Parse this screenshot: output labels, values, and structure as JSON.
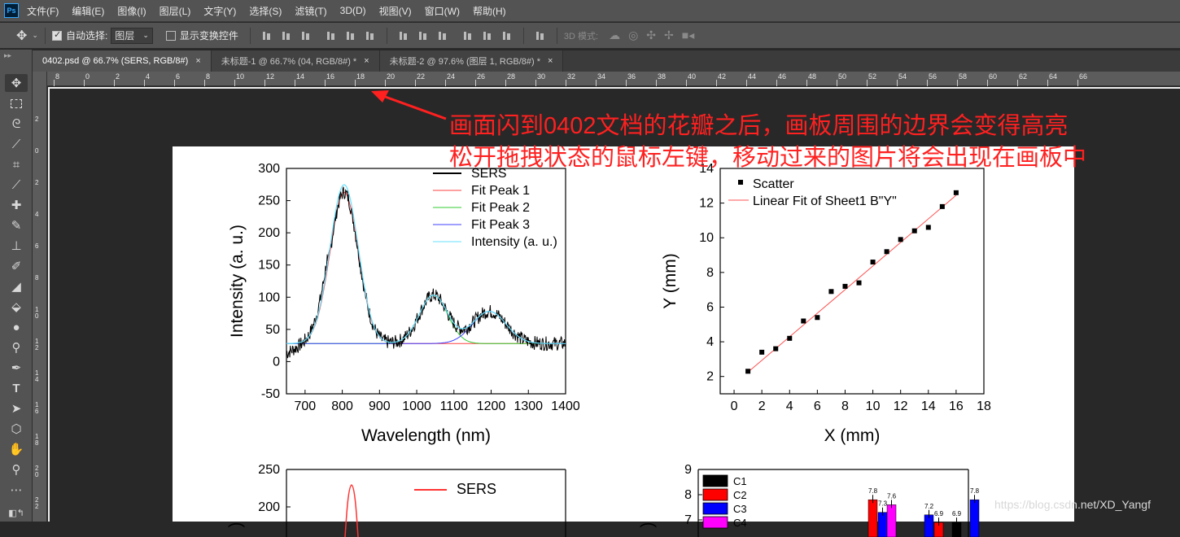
{
  "app": {
    "logo": "Ps"
  },
  "menu": [
    "文件(F)",
    "编辑(E)",
    "图像(I)",
    "图层(L)",
    "文字(Y)",
    "选择(S)",
    "滤镜(T)",
    "3D(D)",
    "视图(V)",
    "窗口(W)",
    "帮助(H)"
  ],
  "options": {
    "auto_select_label": "自动选择:",
    "auto_select_value": "图层",
    "transform_label": "显示变换控件",
    "mode3d_label": "3D 模式:"
  },
  "tabs": [
    {
      "label": "0402.psd @ 66.7% (SERS, RGB/8#)",
      "close": "×"
    },
    {
      "label": "未标题-1 @ 66.7% (04, RGB/8#) *",
      "close": "×"
    },
    {
      "label": "未标题-2 @ 97.6% (图层 1, RGB/8#) *",
      "close": "×"
    }
  ],
  "ruler": {
    "h_labels": [
      "8",
      "0",
      "2",
      "4",
      "6",
      "8",
      "10",
      "12",
      "14",
      "16",
      "18",
      "20",
      "22",
      "24",
      "26",
      "28",
      "30",
      "32",
      "34",
      "36",
      "38",
      "40",
      "42",
      "44",
      "46",
      "48",
      "50",
      "52",
      "54",
      "56",
      "58",
      "60",
      "62",
      "64",
      "66"
    ],
    "v_labels": [
      "2",
      "0",
      "2",
      "4",
      "6",
      "8",
      "1\n0",
      "1\n2",
      "1\n4",
      "1\n6",
      "1\n8",
      "2\n0",
      "2\n2"
    ]
  },
  "annotation": {
    "line1": "画面闪到0402文档的花瓣之后，画板周围的边界会变得高亮",
    "line2": "松开拖拽状态的鼠标左键，移动过来的图片将会出现在画板中",
    "color": "#ff2020"
  },
  "watermark": "https://blog.csdn.net/XD_Yangf",
  "chart_data": [
    {
      "type": "line",
      "xlabel": "Wavelength (nm)",
      "ylabel": "Intensity (a. u.)",
      "xlim": [
        650,
        1400
      ],
      "ylim": [
        -50,
        300
      ],
      "xticks": [
        700,
        800,
        900,
        1000,
        1100,
        1200,
        1300,
        1400
      ],
      "yticks": [
        -50,
        0,
        50,
        100,
        150,
        200,
        250,
        300
      ],
      "legend": [
        "SERS",
        "Fit Peak 1",
        "Fit Peak 2",
        "Fit Peak 3",
        "Intensity (a. u.)"
      ],
      "colors": {
        "SERS": "#000000",
        "Fit Peak 1": "#ff4040",
        "Fit Peak 2": "#33cc33",
        "Fit Peak 3": "#4040ff",
        "Intensity (a. u.)": "#66e0ff"
      },
      "baseline": 28,
      "peaks": [
        {
          "center": 805,
          "height": 235,
          "width": 38
        },
        {
          "center": 1045,
          "height": 75,
          "width": 38
        },
        {
          "center": 1195,
          "height": 50,
          "width": 45
        }
      ],
      "legend_position": "top-right"
    },
    {
      "type": "scatter",
      "xlabel": "X (mm)",
      "ylabel": "Y (mm)",
      "xlim": [
        -1,
        18
      ],
      "ylim": [
        1,
        14
      ],
      "xticks": [
        0,
        2,
        4,
        6,
        8,
        10,
        12,
        14,
        16,
        18
      ],
      "yticks": [
        2,
        4,
        6,
        8,
        10,
        12,
        14
      ],
      "legend": [
        "Scatter",
        "Linear Fit of Sheet1 B\"Y\""
      ],
      "x": [
        1,
        2,
        3,
        4,
        5,
        6,
        7,
        8,
        9,
        10,
        11,
        12,
        13,
        14,
        15,
        16
      ],
      "y": [
        2.3,
        3.4,
        3.6,
        4.2,
        5.2,
        5.4,
        6.9,
        7.2,
        7.4,
        8.6,
        9.2,
        9.9,
        10.4,
        10.6,
        11.8,
        12.6
      ],
      "fit": {
        "x": [
          1,
          16
        ],
        "y": [
          2.25,
          12.45
        ]
      },
      "legend_position": "top-left"
    },
    {
      "type": "line",
      "legend": [
        "SERS"
      ],
      "ylim": [
        150,
        250
      ],
      "yticks": [
        200,
        250
      ],
      "color": "#ff3333",
      "legend_position": "top-right"
    },
    {
      "type": "bar",
      "legend": [
        "C1",
        "C2",
        "C3",
        "C4"
      ],
      "colors": [
        "#000000",
        "#ff0000",
        "#0000ff",
        "#ff00ff"
      ],
      "ylim": [
        6.6,
        9
      ],
      "yticks": [
        7,
        8,
        9
      ],
      "labels": [
        "7.8",
        "7.3",
        "7.6",
        "7.2",
        "6.9",
        "6.9",
        "7.8"
      ],
      "legend_position": "top-left"
    }
  ]
}
